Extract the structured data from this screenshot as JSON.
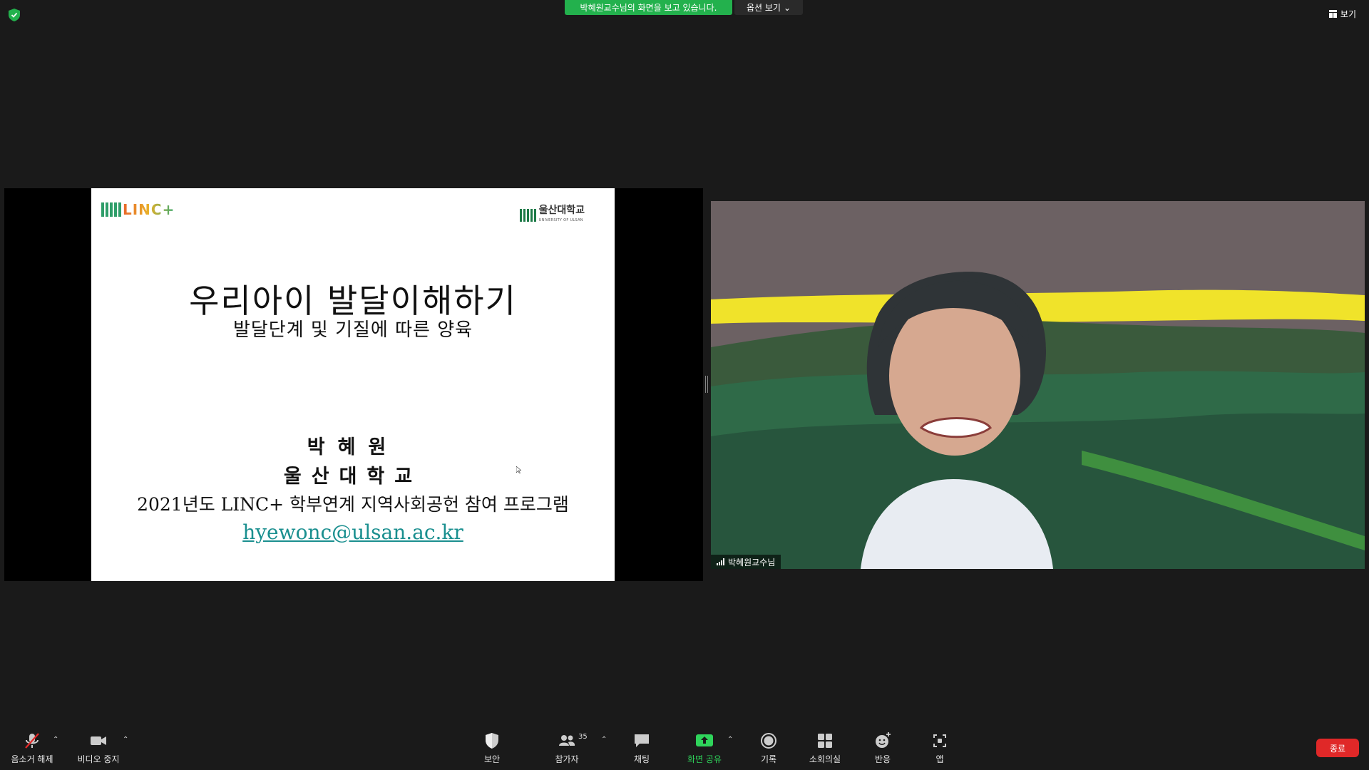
{
  "top": {
    "banner": "박혜원교수님의 화면을 보고 있습니다.",
    "options_label": "옵션 보기",
    "view_label": "보기"
  },
  "slide": {
    "logo_left": "LINC+",
    "logo_right": "울산대학교",
    "logo_right_sub": "UNIVERSITY OF ULSAN",
    "title": "우리아이 발달이해하기",
    "subtitle": "발달단계 및 기질에 따른 양육",
    "name": "박혜원",
    "university": "울산대학교",
    "program": "2021년도 LINC+ 학부연계 지역사회공헌 참여 프로그램",
    "email": "hyewonc@ulsan.ac.kr"
  },
  "video": {
    "participant_name": "박혜원교수님"
  },
  "toolbar": {
    "mute_label": "음소거 해제",
    "video_label": "비디오 중지",
    "security_label": "보안",
    "participants_label": "참가자",
    "participants_count": "35",
    "chat_label": "채팅",
    "share_label": "화면 공유",
    "record_label": "기록",
    "breakout_label": "소회의실",
    "reactions_label": "반응",
    "apps_label": "앱",
    "end_label": "종료"
  },
  "colors": {
    "banner_green": "#23b14d",
    "share_green": "#2fd45b",
    "end_red": "#e02828"
  }
}
